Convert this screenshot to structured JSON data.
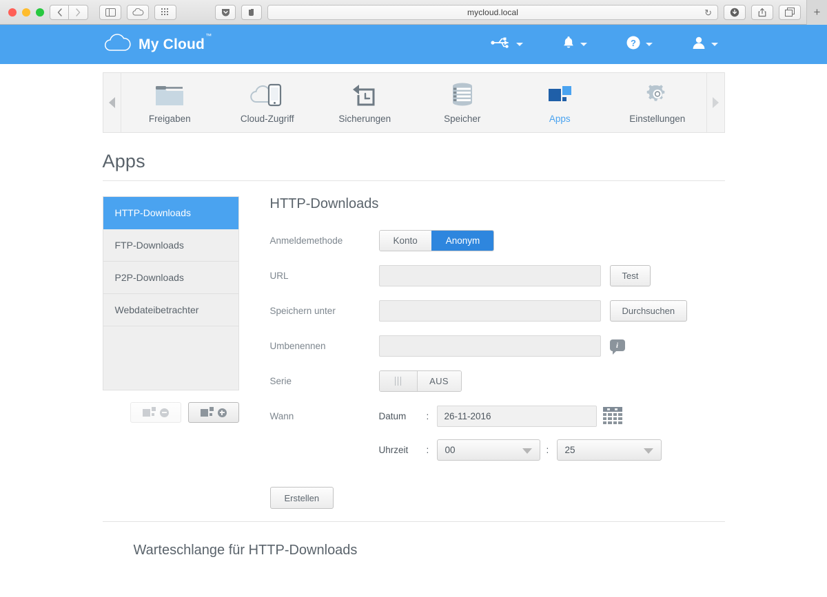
{
  "browser": {
    "traffic_lights": [
      "close",
      "minimize",
      "zoom"
    ],
    "back_label": "‹",
    "forward_label": "›",
    "sidebar_icon": "sidebar-icon",
    "cloud_icon": "icloud-icon",
    "grid_icon": "grid-icon",
    "pocket_icon": "pocket-icon",
    "evernote_icon": "clipper-icon",
    "url": "mycloud.local",
    "reload_glyph": "↻",
    "download_icon": "download-icon",
    "share_icon": "share-icon",
    "tabs_icon": "tab-overview-icon",
    "new_tab_label": "+"
  },
  "header": {
    "brand": "My Cloud",
    "brand_tm": "™",
    "cloud_logo": "cloud-outline-icon",
    "items": [
      {
        "icon": "usb-icon",
        "name": "usb-menu"
      },
      {
        "icon": "bell-icon",
        "name": "notifications-menu"
      },
      {
        "icon": "help-icon",
        "name": "help-menu"
      },
      {
        "icon": "user-icon",
        "name": "account-menu"
      }
    ]
  },
  "nav": {
    "prev_arrow": "chevron-left-icon",
    "next_arrow": "chevron-right-icon",
    "tabs": [
      {
        "label": "Freigaben",
        "icon": "folder-icon",
        "active": false
      },
      {
        "label": "Cloud-Zugriff",
        "icon": "cloud-device-icon",
        "active": false
      },
      {
        "label": "Sicherungen",
        "icon": "backup-icon",
        "active": false
      },
      {
        "label": "Speicher",
        "icon": "storage-icon",
        "active": false
      },
      {
        "label": "Apps",
        "icon": "apps-icon",
        "active": true
      },
      {
        "label": "Einstellungen",
        "icon": "gear-icon",
        "active": false
      }
    ]
  },
  "page": {
    "title": "Apps"
  },
  "sidebar": {
    "items": [
      {
        "label": "HTTP-Downloads",
        "selected": true
      },
      {
        "label": "FTP-Downloads",
        "selected": false
      },
      {
        "label": "P2P-Downloads",
        "selected": false
      },
      {
        "label": "Webdateibetrachter",
        "selected": false
      }
    ],
    "remove_button": {
      "name": "remove-app-button",
      "icon": "app-minus-icon",
      "enabled": false
    },
    "add_button": {
      "name": "add-app-button",
      "icon": "app-plus-icon",
      "enabled": true
    }
  },
  "form": {
    "title": "HTTP-Downloads",
    "login_method": {
      "label": "Anmeldemethode",
      "options": [
        "Konto",
        "Anonym"
      ],
      "selected": "Anonym"
    },
    "url": {
      "label": "URL",
      "value": "",
      "placeholder": "",
      "button": "Test"
    },
    "save_as": {
      "label": "Speichern unter",
      "value": "",
      "placeholder": "",
      "button": "Durchsuchen"
    },
    "rename": {
      "label": "Umbenennen",
      "value": "",
      "placeholder": "",
      "info_icon": "info-icon"
    },
    "series": {
      "label": "Serie",
      "state": "AUS",
      "handle_icon": "grip-icon"
    },
    "when": {
      "label": "Wann",
      "date_label": "Datum",
      "date_value": "26-11-2016",
      "calendar_icon": "calendar-icon",
      "time_label": "Uhrzeit",
      "hour": "00",
      "minute": "25",
      "separator": ":"
    },
    "submit": "Erstellen"
  },
  "queue": {
    "title": "Warteschlange für HTTP-Downloads"
  },
  "colors": {
    "brand_blue": "#4aa3f0",
    "selected_blue": "#2e86de",
    "apps_dark": "#1f5fa8",
    "text_gray": "#5a636b",
    "label_gray": "#7d868e"
  }
}
